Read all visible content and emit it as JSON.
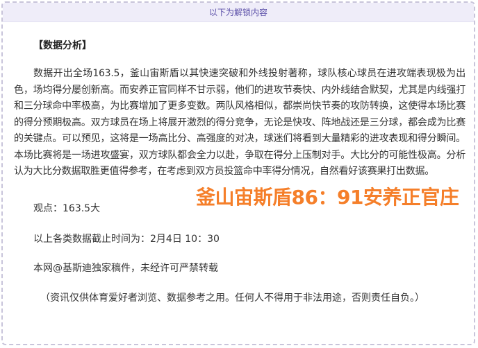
{
  "unlock_header": "以下为解锁内容",
  "section_title": "【数据分析】",
  "analysis_text": "数据开出全场163.5，釜山宙斯盾以其快速突破和外线投射著称，球队核心球员在进攻端表现极为出色，场均得分屡创新高。而安养正官同样不甘示弱，他们的进攻节奏快、内外线结合默契，尤其是内线强打和三分球命中率极高，为比赛增加了更多变数。两队风格相似，都崇尚快节奏的攻防转换，这使得本场比赛的得分预期极高。双方球员在场上将展开激烈的得分竞争，无论是快攻、阵地战还是三分球，都会成为比赛的关键点。可以预见，这将是一场高比分、高强度的对决，球迷们将看到大量精彩的进攻表现和得分瞬间。本场比赛将是一场进攻盛宴，双方球队都会全力以赴，争取在得分上压制对手。大比分的可能性极高。分析认为大比分数据取胜更值得参考，在考虑到双方员投篮命中率得分情况，自然看好该赛果打出数据。",
  "viewpoint": "观点：163.5大",
  "data_cutoff": "以上各类数据截止时间为：2月4日 10：30",
  "copyright": "本网@基斯迪独家稿件，未经许可严禁转载",
  "disclaimer": "（资讯仅供体育爱好者浏览、数据参考之用。任何人不得用于非法用途，否则责任自负。）",
  "score_overlay": "釜山宙斯盾86：91安养正官庄",
  "colors": {
    "header_bg": "#efedf9",
    "header_text": "#5b4fa8",
    "border": "#c8c4da",
    "body_text": "#333333",
    "score_overlay": "#f57f2a"
  }
}
